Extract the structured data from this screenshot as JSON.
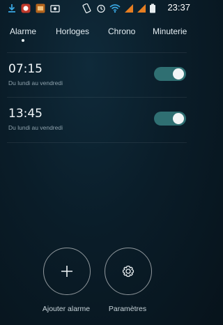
{
  "status_bar": {
    "time": "23:37",
    "icons": [
      "download-icon",
      "chat-icon",
      "app-icon",
      "photo-icon",
      "vibrate-icon",
      "alarm-clock-icon",
      "wifi-icon",
      "signal-icon",
      "signal-icon",
      "battery-icon"
    ]
  },
  "tabs": [
    {
      "label": "Alarme",
      "active": true
    },
    {
      "label": "Horloges",
      "active": false
    },
    {
      "label": "Chrono",
      "active": false
    },
    {
      "label": "Minuterie",
      "active": false
    }
  ],
  "alarms": [
    {
      "time": "07:15",
      "days": "Du lundi au vendredi",
      "enabled": true
    },
    {
      "time": "13:45",
      "days": "Du lundi au vendredi",
      "enabled": true
    }
  ],
  "actions": {
    "add_label": "Ajouter alarme",
    "settings_label": "Paramètres"
  },
  "colors": {
    "accent": "#2f6f72",
    "background": "#0a1d29"
  }
}
